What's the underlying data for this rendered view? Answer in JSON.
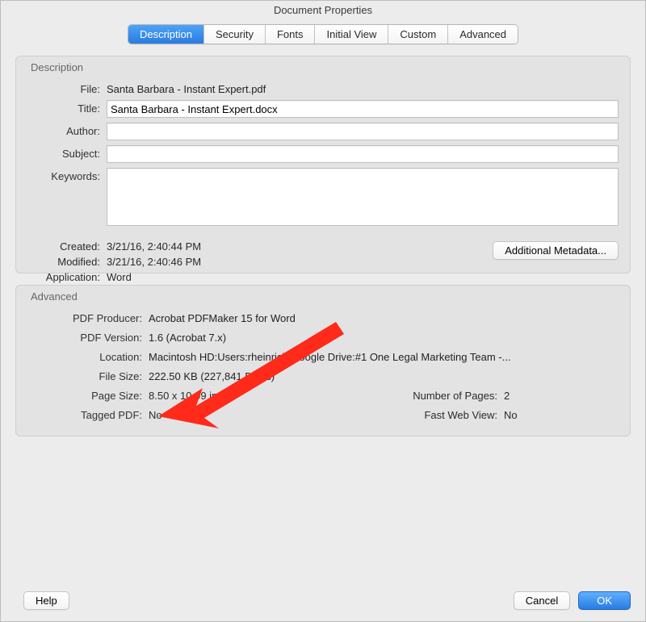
{
  "window": {
    "title": "Document Properties"
  },
  "tabs": {
    "items": [
      "Description",
      "Security",
      "Fonts",
      "Initial View",
      "Custom",
      "Advanced"
    ],
    "active_index": 0
  },
  "description_group": {
    "legend": "Description",
    "file_label": "File:",
    "file_value": "Santa Barbara - Instant Expert.pdf",
    "title_label": "Title:",
    "title_value": "Santa Barbara - Instant Expert.docx",
    "author_label": "Author:",
    "author_value": "",
    "subject_label": "Subject:",
    "subject_value": "",
    "keywords_label": "Keywords:",
    "keywords_value": "",
    "created_label": "Created:",
    "created_value": "3/21/16, 2:40:44 PM",
    "modified_label": "Modified:",
    "modified_value": "3/21/16, 2:40:46 PM",
    "application_label": "Application:",
    "application_value": "Word",
    "additional_metadata_button": "Additional Metadata..."
  },
  "advanced_group": {
    "legend": "Advanced",
    "pdf_producer_label": "PDF Producer:",
    "pdf_producer_value": "Acrobat PDFMaker 15 for Word",
    "pdf_version_label": "PDF Version:",
    "pdf_version_value": "1.6 (Acrobat 7.x)",
    "location_label": "Location:",
    "location_value": "Macintosh HD:Users:rheinrich:Google Drive:#1 One Legal Marketing Team -...",
    "file_size_label": "File Size:",
    "file_size_value": "222.50 KB (227,841 Bytes)",
    "page_size_label": "Page Size:",
    "page_size_value": "8.50 x 10.99 in",
    "num_pages_label": "Number of Pages:",
    "num_pages_value": "2",
    "tagged_pdf_label": "Tagged PDF:",
    "tagged_pdf_value": "No",
    "fast_web_label": "Fast Web View:",
    "fast_web_value": "No"
  },
  "footer": {
    "help": "Help",
    "cancel": "Cancel",
    "ok": "OK"
  }
}
